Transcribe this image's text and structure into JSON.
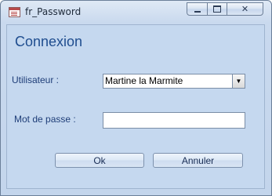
{
  "window": {
    "title": "fr_Password",
    "icon": "form-icon",
    "controls": {
      "minimize": "minimize-icon",
      "maximize": "maximize-icon",
      "close": "✕"
    }
  },
  "form": {
    "heading": "Connexion",
    "user_label": "Utilisateur :",
    "user_value": "Martine la Marmite",
    "password_label": "Mot de passe :",
    "password_value": "",
    "ok_label": "Ok",
    "cancel_label": "Annuler"
  },
  "colors": {
    "heading": "#1f4d8f",
    "label": "#1f3e78",
    "background": "#c5d8ef"
  }
}
